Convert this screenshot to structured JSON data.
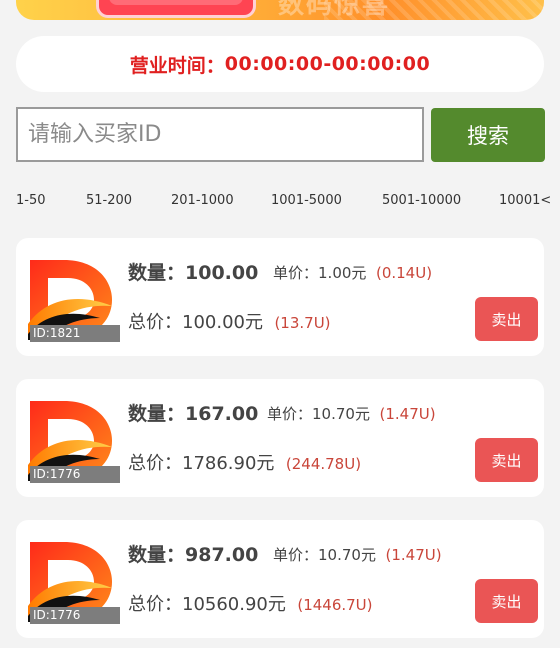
{
  "banner": {
    "ghost_text": "数码惊喜"
  },
  "hours": {
    "label": "营业时间：",
    "value": "00:00:00-00:00:00"
  },
  "search": {
    "placeholder": "请输入买家ID",
    "value": "",
    "button_label": "搜索"
  },
  "range_tabs": [
    "1-50",
    "51-200",
    "201-1000",
    "1001-5000",
    "5001-10000",
    "10001<"
  ],
  "labels": {
    "qty": "数量：",
    "unit_price": "单价：",
    "total": "总价：",
    "sell": "卖出"
  },
  "orders": [
    {
      "id": "ID:1821",
      "qty": "100.00",
      "unit_price": "1.00元",
      "unit_usdt": "(0.14U)",
      "total": "100.00元",
      "total_usdt": "(13.7U)"
    },
    {
      "id": "ID:1776",
      "qty": "167.00",
      "unit_price": "10.70元",
      "unit_usdt": "(1.47U)",
      "total": "1786.90元",
      "total_usdt": "(244.78U)"
    },
    {
      "id": "ID:1776",
      "qty": "987.00",
      "unit_price": "10.70元",
      "unit_usdt": "(1.47U)",
      "total": "10560.90元",
      "total_usdt": "(1446.7U)"
    }
  ],
  "colors": {
    "accent_red": "#e02020",
    "search_green": "#548a2d",
    "sell_red": "#ea5555",
    "usdt_red": "#c9463a"
  }
}
